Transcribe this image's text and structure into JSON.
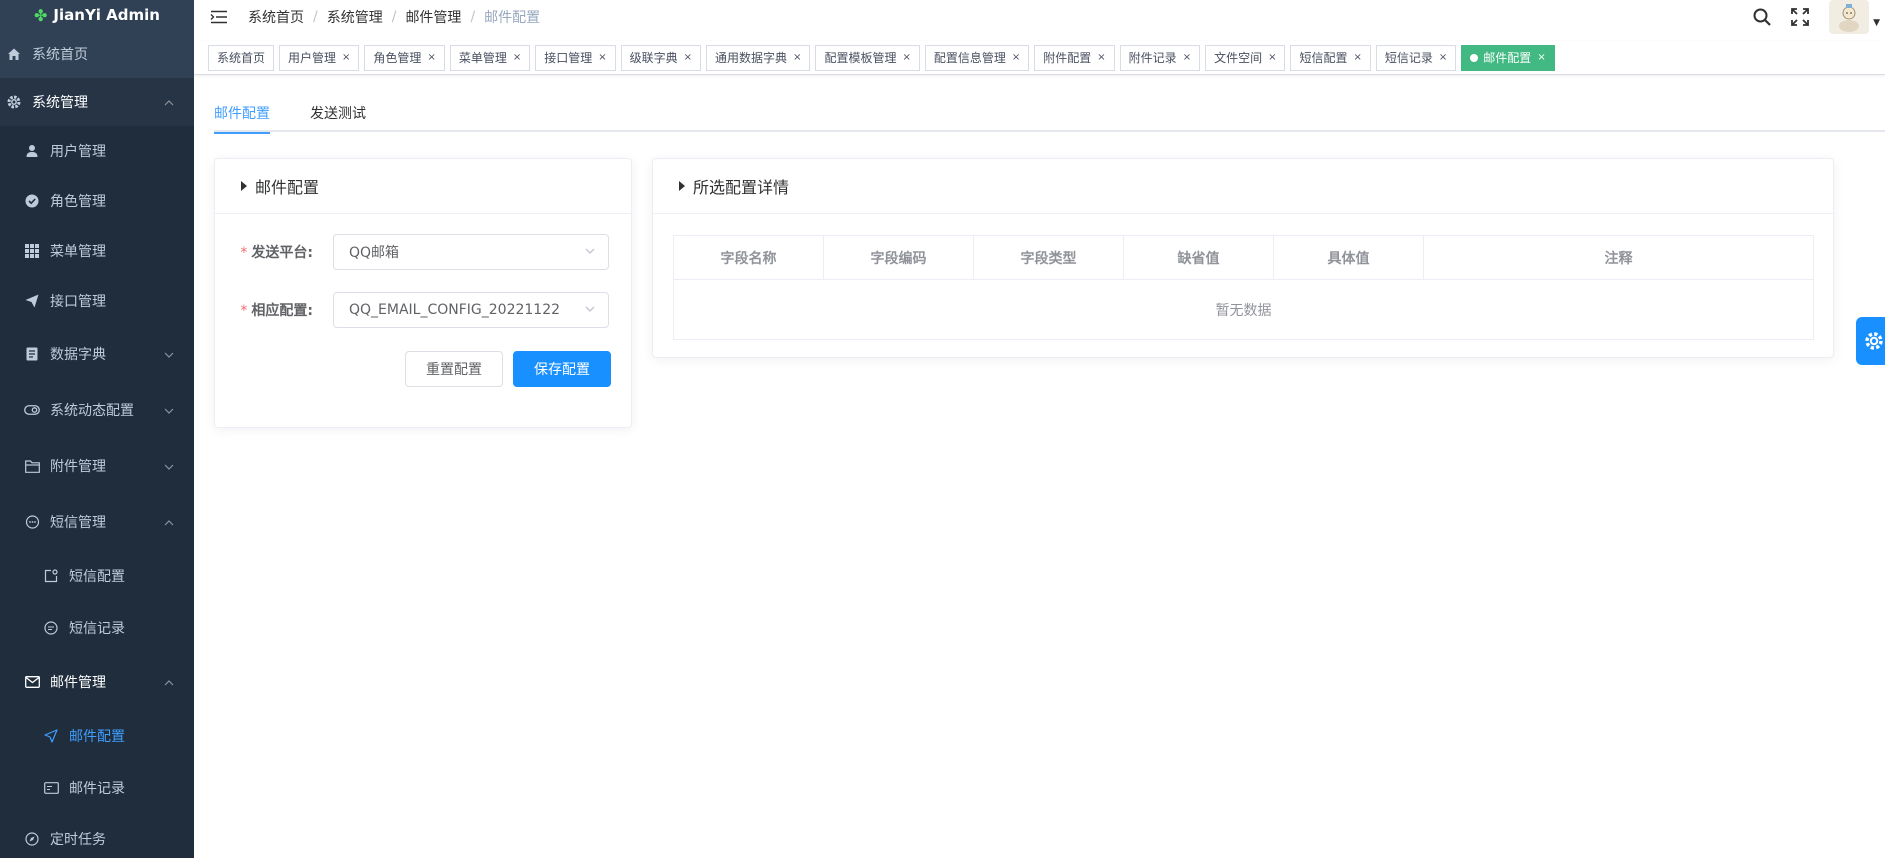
{
  "app": {
    "title": "JianYi Admin"
  },
  "sidebar": {
    "items": [
      {
        "label": "系统首页",
        "icon": "home-icon"
      },
      {
        "label": "系统管理",
        "icon": "gear-icon",
        "expanded": true
      },
      {
        "label": "用户管理",
        "icon": "user-icon"
      },
      {
        "label": "角色管理",
        "icon": "check-circle-icon"
      },
      {
        "label": "菜单管理",
        "icon": "grid-icon"
      },
      {
        "label": "接口管理",
        "icon": "send-icon"
      },
      {
        "label": "数据字典",
        "icon": "notebook-icon",
        "expanded": false
      },
      {
        "label": "系统动态配置",
        "icon": "toggle-icon",
        "expanded": false
      },
      {
        "label": "附件管理",
        "icon": "folder-icon",
        "expanded": false
      },
      {
        "label": "短信管理",
        "icon": "chat-icon",
        "expanded": true
      },
      {
        "label": "短信配置",
        "icon": "edit-square-icon"
      },
      {
        "label": "短信记录",
        "icon": "chat-dots-icon"
      },
      {
        "label": "邮件管理",
        "icon": "mail-icon",
        "expanded": true
      },
      {
        "label": "邮件配置",
        "icon": "position-icon",
        "active": true
      },
      {
        "label": "邮件记录",
        "icon": "postcard-icon"
      },
      {
        "label": "定时任务",
        "icon": "compass-icon"
      }
    ]
  },
  "breadcrumb": [
    "系统首页",
    "系统管理",
    "邮件管理",
    "邮件配置"
  ],
  "tags": [
    {
      "label": "系统首页",
      "closable": false
    },
    {
      "label": "用户管理",
      "closable": true
    },
    {
      "label": "角色管理",
      "closable": true
    },
    {
      "label": "菜单管理",
      "closable": true
    },
    {
      "label": "接口管理",
      "closable": true
    },
    {
      "label": "级联字典",
      "closable": true
    },
    {
      "label": "通用数据字典",
      "closable": true
    },
    {
      "label": "配置模板管理",
      "closable": true
    },
    {
      "label": "配置信息管理",
      "closable": true
    },
    {
      "label": "附件配置",
      "closable": true
    },
    {
      "label": "附件记录",
      "closable": true
    },
    {
      "label": "文件空间",
      "closable": true
    },
    {
      "label": "短信配置",
      "closable": true
    },
    {
      "label": "短信记录",
      "closable": true
    },
    {
      "label": "邮件配置",
      "closable": true,
      "active": true
    }
  ],
  "tag_close": "×",
  "tabs": [
    {
      "label": "邮件配置",
      "active": true
    },
    {
      "label": "发送测试",
      "active": false
    }
  ],
  "config_card": {
    "title": "邮件配置",
    "platform": {
      "label": "发送平台:",
      "required": "*",
      "value": "QQ邮箱"
    },
    "config": {
      "label": "相应配置:",
      "required": "*",
      "value": "QQ_EMAIL_CONFIG_20221122"
    },
    "reset_button": "重置配置",
    "save_button": "保存配置"
  },
  "detail_card": {
    "title": "所选配置详情",
    "columns": [
      "字段名称",
      "字段编码",
      "字段类型",
      "缺省值",
      "具体值",
      "注释"
    ],
    "empty_text": "暂无数据"
  },
  "colors": {
    "sidebar_bg": "#304156",
    "accent": "#409eff",
    "primary_button": "#1890ff",
    "active_tag": "#42b983"
  }
}
